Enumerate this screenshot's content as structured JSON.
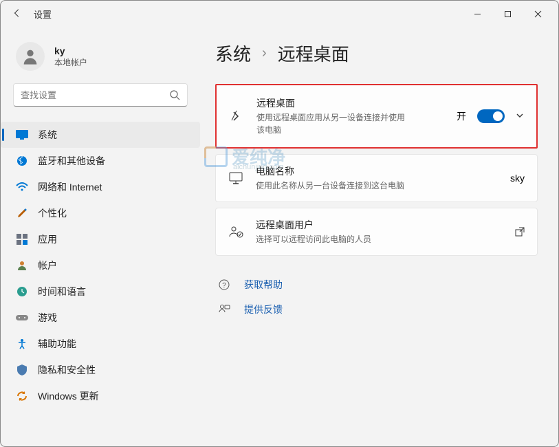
{
  "titlebar": {
    "title": "设置"
  },
  "profile": {
    "name": "ky",
    "sub": "本地帐户"
  },
  "search": {
    "placeholder": "查找设置"
  },
  "nav": {
    "items": [
      {
        "label": "系统"
      },
      {
        "label": "蓝牙和其他设备"
      },
      {
        "label": "网络和 Internet"
      },
      {
        "label": "个性化"
      },
      {
        "label": "应用"
      },
      {
        "label": "帐户"
      },
      {
        "label": "时间和语言"
      },
      {
        "label": "游戏"
      },
      {
        "label": "辅助功能"
      },
      {
        "label": "隐私和安全性"
      },
      {
        "label": "Windows 更新"
      }
    ]
  },
  "breadcrumb": {
    "root": "系统",
    "current": "远程桌面"
  },
  "cards": {
    "remote": {
      "title": "远程桌面",
      "sub": "使用远程桌面应用从另一设备连接并使用该电脑",
      "state": "开"
    },
    "pcname": {
      "title": "电脑名称",
      "sub": "使用此名称从另一台设备连接到这台电脑",
      "value": "sky"
    },
    "users": {
      "title": "远程桌面用户",
      "sub": "选择可以远程访问此电脑的人员"
    }
  },
  "links": {
    "help": "获取帮助",
    "feedback": "提供反馈"
  },
  "watermark": {
    "text": "爱纯净",
    "sub": "aichunjing.com"
  }
}
